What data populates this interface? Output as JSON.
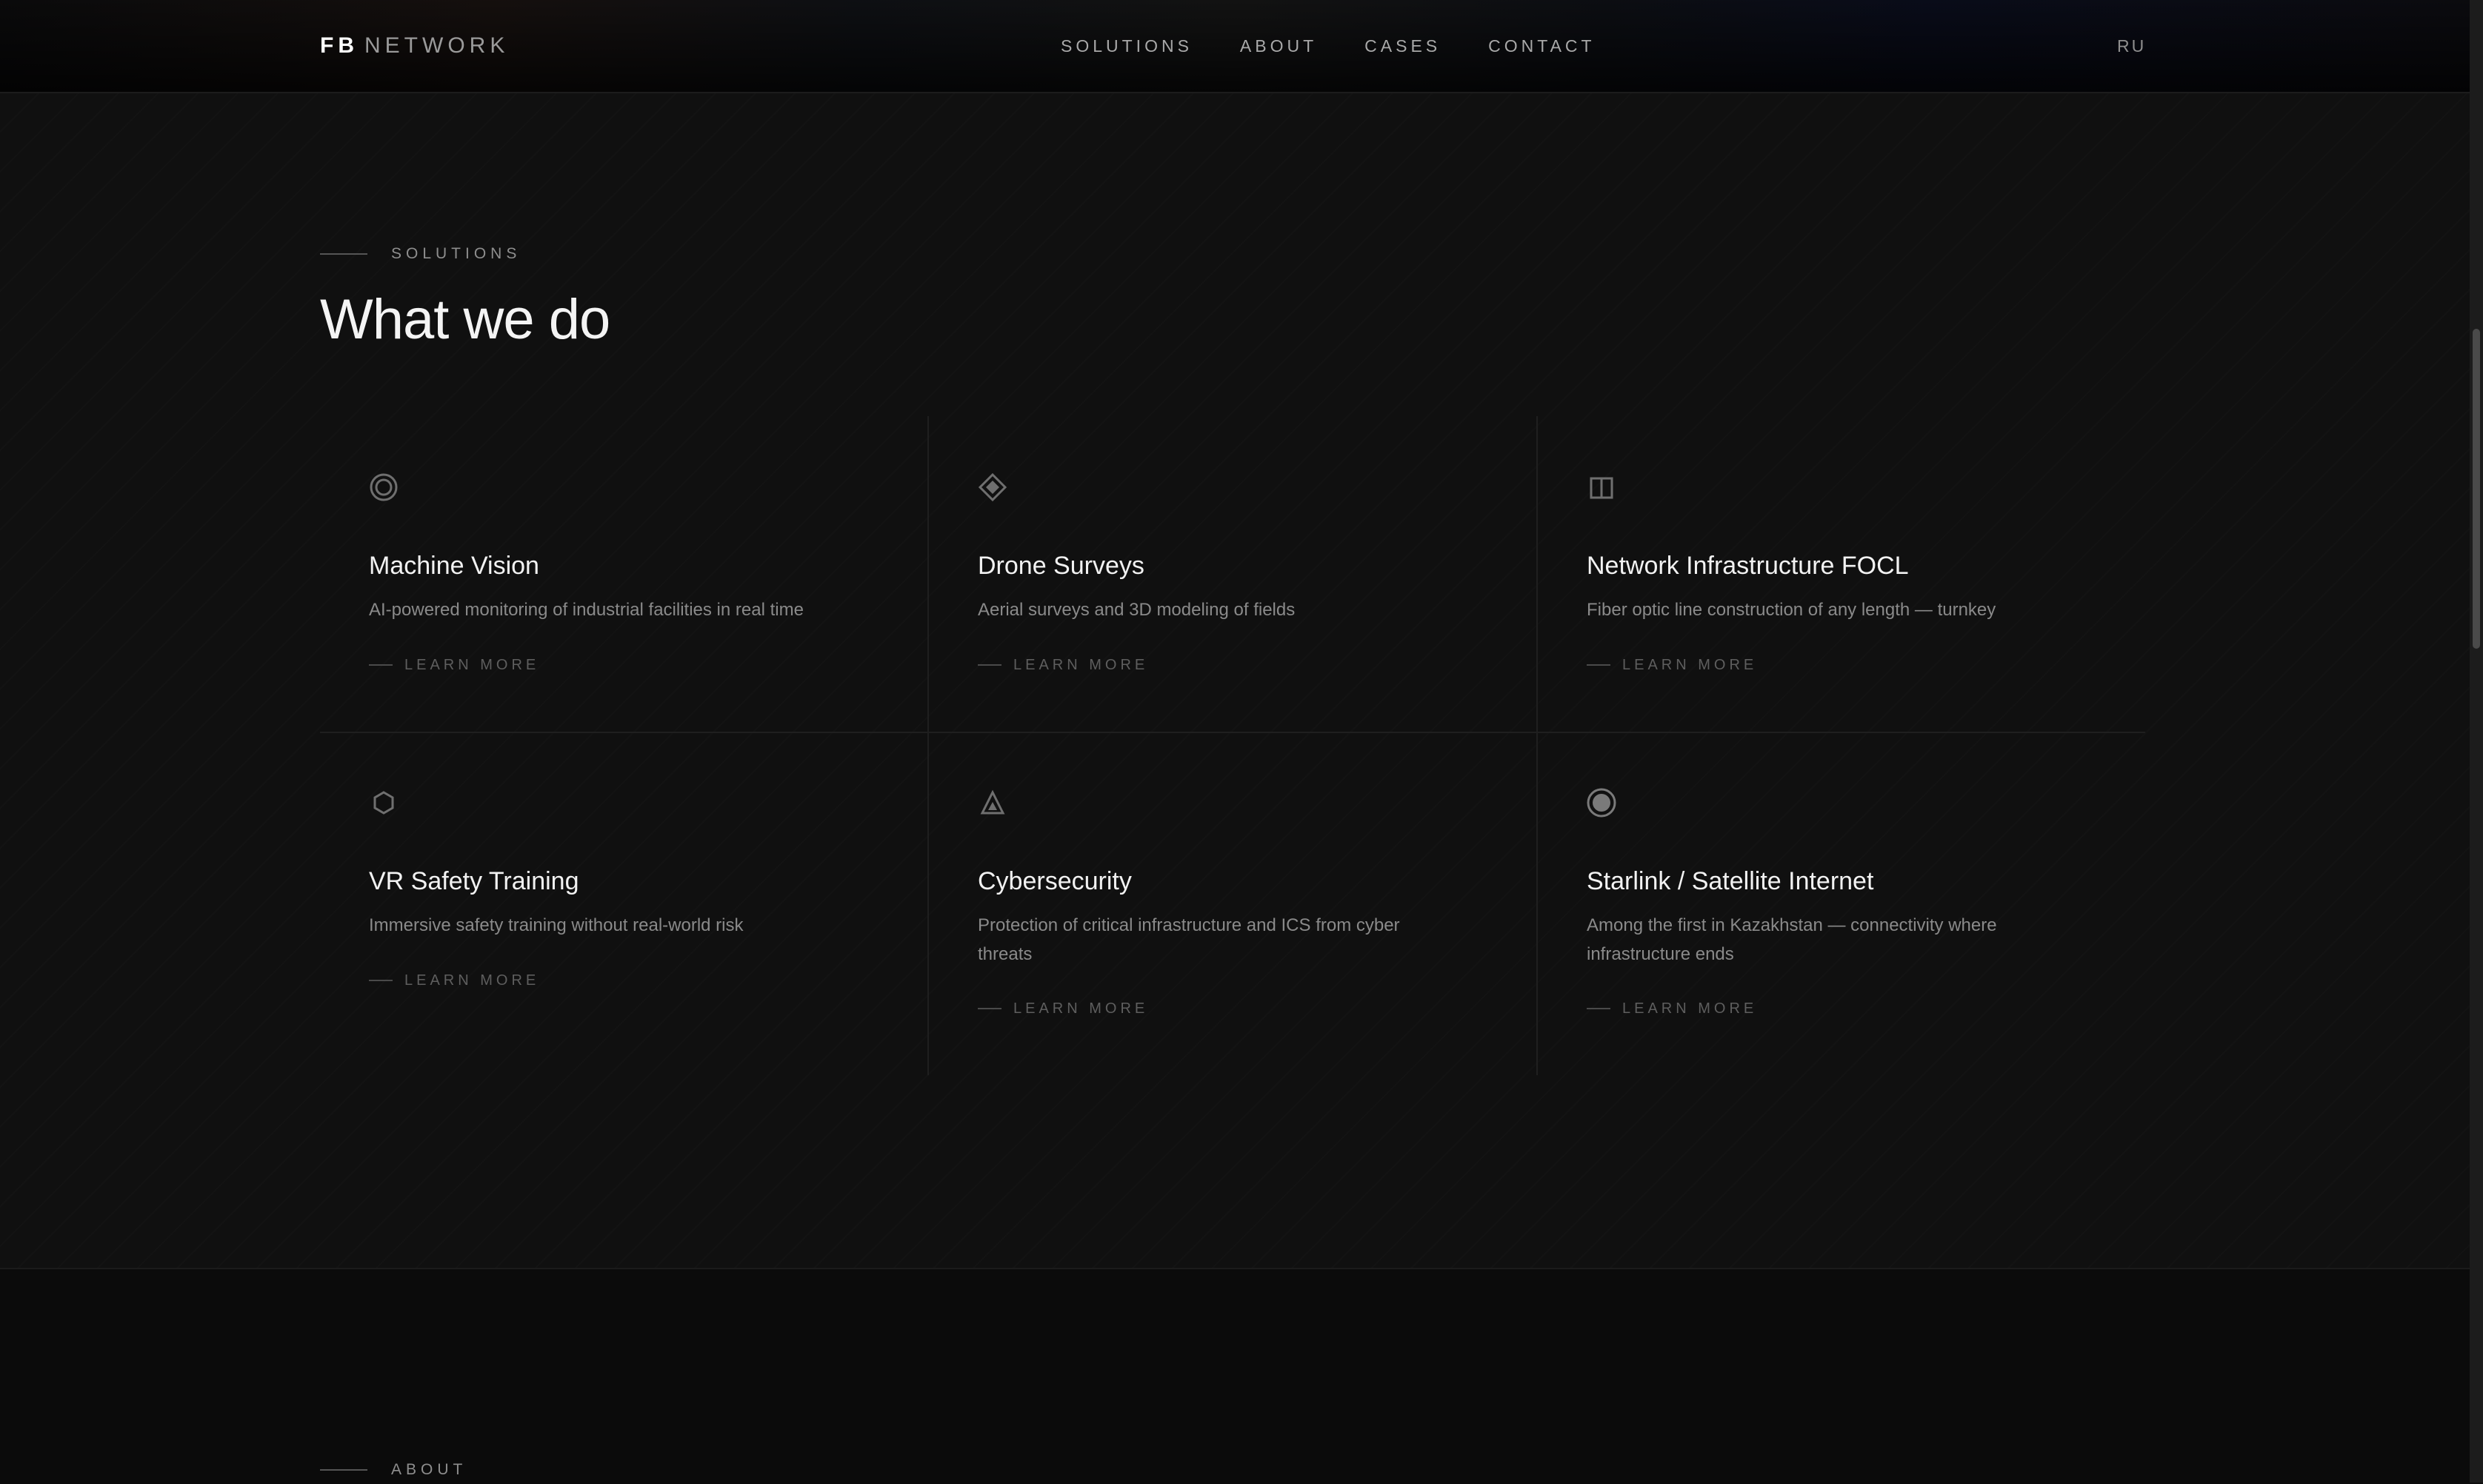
{
  "header": {
    "logo_strong": "FB",
    "logo_light": "NETWORK",
    "nav": [
      "SOLUTIONS",
      "ABOUT",
      "CASES",
      "CONTACT"
    ],
    "lang": "RU"
  },
  "solutions": {
    "eyebrow": "SOLUTIONS",
    "title": "What we do",
    "cards": [
      {
        "icon": "target-icon",
        "title": "Machine Vision",
        "desc": "AI-powered monitoring of industrial facilities in real time",
        "more": "LEARN MORE"
      },
      {
        "icon": "diamond-icon",
        "title": "Drone Surveys",
        "desc": "Aerial surveys and 3D modeling of fields",
        "more": "LEARN MORE"
      },
      {
        "icon": "split-square-icon",
        "title": "Network Infrastructure FOCL",
        "desc": "Fiber optic line construction of any length — turnkey",
        "more": "LEARN MORE"
      },
      {
        "icon": "hexagon-icon",
        "title": "VR Safety Training",
        "desc": "Immersive safety training without real-world risk",
        "more": "LEARN MORE"
      },
      {
        "icon": "warning-triangle-icon",
        "title": "Cybersecurity",
        "desc": "Protection of critical infrastructure and ICS from cyber threats",
        "more": "LEARN MORE"
      },
      {
        "icon": "satellite-dot-icon",
        "title": "Starlink / Satellite Internet",
        "desc": "Among the first in Kazakhstan — connectivity where infrastructure ends",
        "more": "LEARN MORE"
      }
    ]
  },
  "about": {
    "eyebrow": "ABOUT"
  },
  "colors": {
    "background": "#101010",
    "text": "#ffffff",
    "muted": "#8a8a8a",
    "divider": "#1f1f1f"
  }
}
